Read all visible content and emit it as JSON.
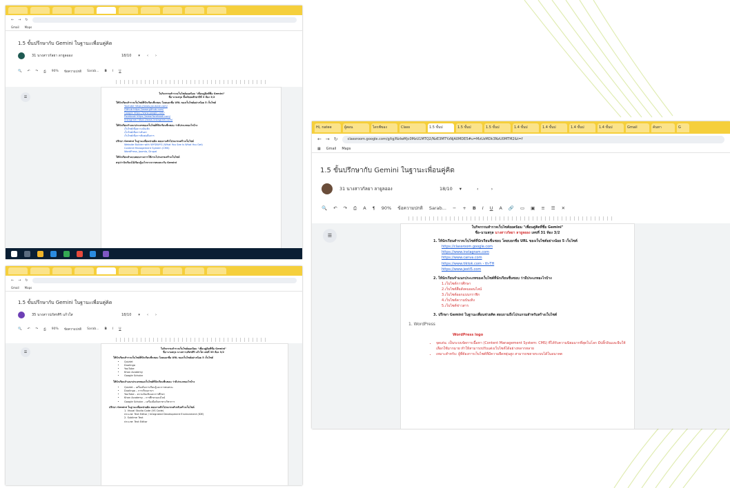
{
  "common": {
    "doc_title": "1.5 ขั้นปรึกษากับ Gemini ในฐานะเพื่อนคู่คิด",
    "bookmarks": [
      "Gmail",
      "Maps"
    ],
    "zoom": "90%",
    "font": "Sarab...",
    "style": "ข้อความปกติ",
    "colors": {
      "tabbar": "#f5cf3c",
      "link": "#1a5bd8",
      "red": "#d32f2f"
    }
  },
  "top_left": {
    "owner": "31 นางสาวกัลยา ลายูลออง",
    "date": "18/10",
    "doc_heading": "ใบกิจกรรมสำรวจเว็บไซต์ยอดนิยม \"เพื่อนคู่คิดที่ชื่อ Gemini\"",
    "doc_sub": "ชื่อ-นามสกุล ชั้นมัธยมศึกษาปีที่ 3 ห้อง 3/2",
    "q1": "ให้นักเรียนสำรวจเว็บไซต์ที่นักเรียนชื่นชอบ โดยบอกชื่อ URL ของเว็บไซต์อย่างน้อย 5 เว็บไซต์",
    "q1_links": [
      "Youtube https://www.youtube.com/",
      "Github https://www.github.com/",
      "Google https://www.google.com/",
      "Facebook https://www.facebook.com/",
      "Instagram https://www.instagram.com/"
    ],
    "q2": "ให้นักเรียนจำแนกประเภทของเว็บไซต์ที่นักเรียนชื่นชอบ ว่ามีประเภทอะไรบ้าง",
    "q2_items": [
      "เว็บไซต์เพื่อความบันเทิง",
      "เว็บไซต์เพื่อการค้นหา",
      "เว็บไซต์เพื่อการติดต่อสื่อสาร"
    ],
    "q3": "ปรึกษา Gemini ในฐานะเพื่อนช่วยคิด สอบถามถึงโปรแกรมสร้างเว็บไซต์",
    "q3_text": [
      "Website Builder with WYSIWYG (What You See Is What You Get)",
      "Content Management System (CMS)",
      "WordPress, Joomla, Drupal"
    ],
    "q4": "ให้นักเรียนทำแบบสอบถามการใช้งานโปรแกรมสร้างเว็บไซต์",
    "q5": "สรุปว่านักเรียนได้เรียนรู้อะไรจากการสนทนากับ Gemini"
  },
  "bottom_left": {
    "owner": "35 นางสาวปภัสรศิริ แก้วใส",
    "date": "18/10",
    "doc_heading": "ใบกิจกรรมสำรวจเว็บไซต์ยอดนิยม \"เพื่อนคู่คิดที่ชื่อ Gemini\"",
    "doc_sub": "ชื่อ-นามสกุล นางสาวปภัสรศิริ แก้วใส เลขที่ 35 ห้อง 3/2",
    "q1": "ให้นักเรียนสำรวจเว็บไซต์ที่นักเรียนชื่นชอบ โดยบอกชื่อ URL ของเว็บไซต์อย่างน้อย 5 เว็บไซต์",
    "q1_items": [
      "Quizlet",
      "Duolingo",
      "YouTube",
      "Khan Academy",
      "Google Scholar"
    ],
    "q2": "ให้นักเรียนจำแนกประเภทของเว็บไซต์ที่นักเรียนชื่นชอบ ว่ามีประเภทอะไรบ้าง",
    "q2_items": [
      "Quizlet – เครื่องมือการเรียนรู้และการทบทวน",
      "Duolingo – การเรียนภาษา",
      "YouTube – ความบันเทิงและการศึกษา",
      "Khan Academy – การศึกษาออนไลน์",
      "Google Scholar – เครื่องมือค้นหาทางวิชาการ"
    ],
    "q3": "ปรึกษา Gemini ในฐานะเพื่อนช่วยคิด สอบถามถึงโปรแกรมสำหรับสร้างเว็บไซต์",
    "q3_items": [
      "1. Visual Studio Code (VS Code)",
      "ประเภท: Text Editor / Integrated Development Environment (IDE)",
      "2. Sublime Text",
      "ประเภท: Text Editor"
    ]
  },
  "right": {
    "tabs": [
      "Hi, natee",
      "ผู้สอน",
      "ไดรฟ์ของ",
      "Class",
      "1.5 ขั้นป",
      "1.5 ขั้นป",
      "1.5 ขั้นป",
      "1.4 ขั้นป",
      "1.4 ขั้นป",
      "1.4 ขั้นป",
      "1.4 ขั้นป",
      "Gmail",
      "ค้นหา",
      "G"
    ],
    "url": "classroom.google.com/g/tg/NzIwMjc0MzU1MTQ2/NzE3MTYzNjA0MDE5#u=MzUzMDk3NzU0MTM2&t=f",
    "owner": "31 นางสาวกัลยา ลายูลออง",
    "date": "18/10",
    "doc_heading": "ใบกิจกรรมสำรวจเว็บไซต์ยอดนิยม \"เพื่อนคู่คิดที่ชื่อ Gemini\"",
    "doc_sub_label": "ชื่อ-นามสกุล",
    "doc_sub_name": "นางสาวกัลยา ลายูลออง",
    "doc_sub_rest": "เลขที่ 31 ห้อง 3/2",
    "q1": "ให้นักเรียนสำรวจเว็บไซต์ที่นักเรียนชื่นชอบ โดยบอกชื่อ URL ของเว็บไซต์อย่างน้อย 5 เว็บไซต์",
    "q1_links": [
      "https://classroom.google.com",
      "https://www.instagram.com",
      "https://www.canva.com",
      "https://www.tiktok.com › th-TH",
      "https://www.jesti5.com"
    ],
    "q2": "ให้นักเรียนจำแนกประเภทของเว็บไซต์ที่นักเรียนชื่นชอบ ว่ามีประเภทอะไรบ้าง",
    "q2_items": [
      "1.เว็บไซต์การศึกษา",
      "2.เว็บไซต์สื่อสังคมออนไลน์",
      "3.เว็บไซต์ออกแบบกราฟิก",
      "4.เว็บไซต์ความบันเทิง",
      "5.เว็บไซต์ข่าวสาร"
    ],
    "q3": "ปรึกษา Gemini ในฐานะเพื่อนช่วยคิด สอบถามถึงโปรแกรมสำหรับสร้างเว็บไซต์",
    "wp_label": "1. WordPress",
    "wp_logo": "WordPress logo",
    "wp_points": [
      "จุดเด่น: เป็นระบบจัดการเนื้อหา (Content Management System: CMS) ที่ได้รับความนิยมมากที่สุดในโลก มีปลั๊กอินและธีมให้เลือกใช้มากมาย ทำให้สามารถปรับแต่งเว็บไซต์ได้อย่างหลากหลาย",
      "เหมาะสำหรับ: ผู้ที่ต้องการเว็บไซต์ที่มีความยืดหยุ่นสูง สามารถขยายระบบได้ในอนาคต"
    ]
  }
}
